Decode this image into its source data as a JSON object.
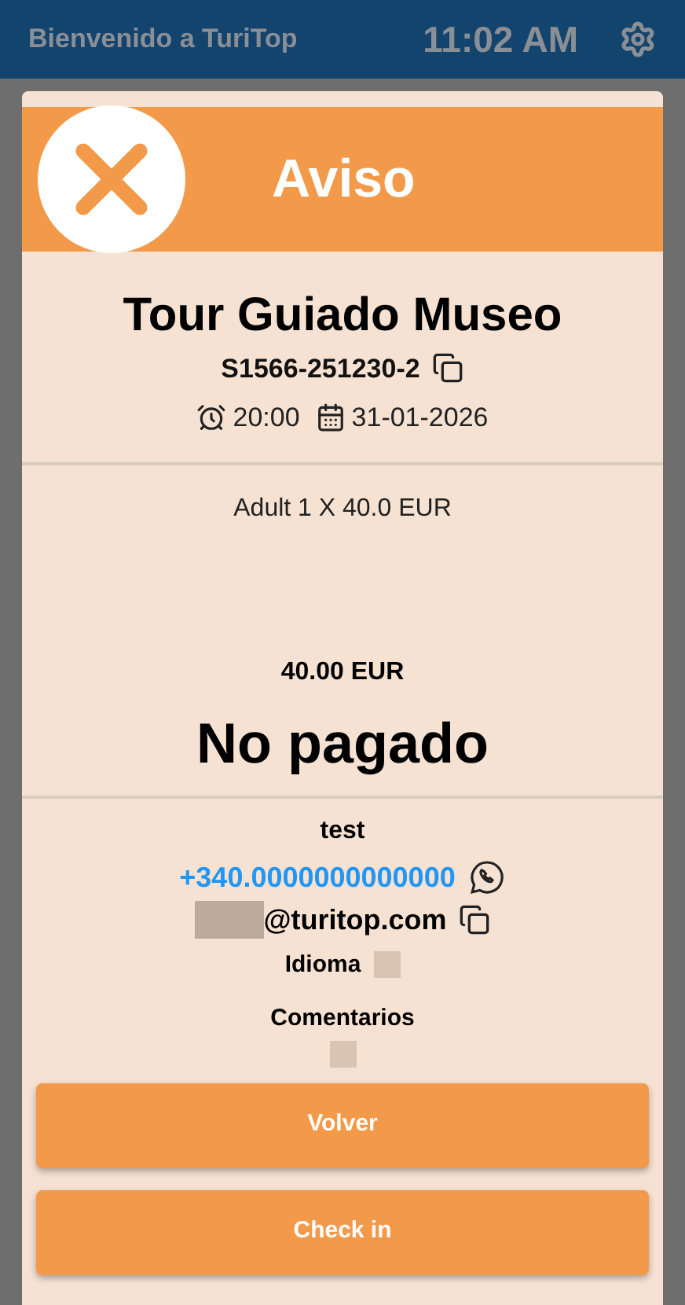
{
  "app_bar": {
    "title": "Bienvenido a TuriTop",
    "time": "11:02 AM"
  },
  "dialog": {
    "title": "Aviso",
    "tour": "Tour Guiado Museo",
    "booking_code": "S1566-251230-2",
    "time": "20:00",
    "date": "31-01-2026",
    "line_items": [
      "Adult 1 X 40.0 EUR"
    ],
    "total": "40.00 EUR",
    "payment_status": "No pagado",
    "customer_name": "test",
    "phone": "+340.0000000000000",
    "email": "@turitop.com",
    "language_label": "Idioma",
    "comments_label": "Comentarios",
    "buttons": [
      "Volver",
      "Check in"
    ]
  }
}
